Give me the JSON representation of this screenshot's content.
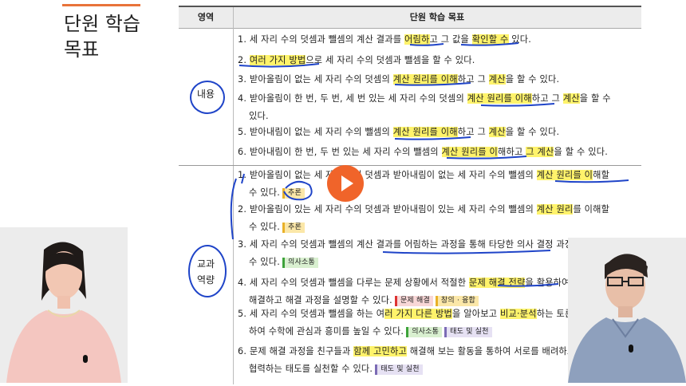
{
  "page": {
    "title_line1": "단원 학습",
    "title_line2": "목표"
  },
  "table": {
    "header_area": "영역",
    "header_goal": "단원 학습 목표",
    "sections": [
      {
        "area": "내용",
        "items": [
          {
            "n": "1.",
            "parts": [
              "세 자리 수의 덧셈과 뺄셈의 계산 결과를 ",
              "어림하",
              "고 그 값을 ",
              "확인할 수",
              " 있다."
            ]
          },
          {
            "n": "2.",
            "parts": [
              "",
              "여러 가지 방법",
              "으로 세 자리 수의 덧셈과 뺄셈을 할 수 있다."
            ]
          },
          {
            "n": "3.",
            "parts": [
              "받아올림이 없는 세 자리 수의 덧셈의 ",
              "계산 원리를 이해",
              "하고 그 ",
              "계산",
              "을 할 수 있다."
            ]
          },
          {
            "n": "4.",
            "parts": [
              "받아올림이 한 번, 두 번, 세 번 있는 세 자리 수의 덧셈의 ",
              "계산 원리를 이해",
              "하고 그 ",
              "계산",
              "을 할 수"
            ],
            "cont": "있다."
          },
          {
            "n": "5.",
            "parts": [
              "받아내림이 없는 세 자리 수의 뺄셈의 ",
              "계산 원리를 이해",
              "하고 그 ",
              "계산",
              "을 할 수 있다."
            ]
          },
          {
            "n": "6.",
            "parts": [
              "받아내림이 한 번, 두 번 있는 세 자리 수의 뺄셈의 ",
              "계산 원리를 이",
              "해하고 ",
              "그 계산",
              "을 할 수 있다."
            ]
          }
        ]
      },
      {
        "area_line1": "교과",
        "area_line2": "역량",
        "items": [
          {
            "n": "1.",
            "parts": [
              "받아올림이 없는 세 자리 수의 덧셈과 받아내림이 없는 세 자리 수의 뺄셈의 ",
              "계산 원리를 이",
              "해할"
            ],
            "cont": "수 있다.",
            "tags": [
              "추론"
            ]
          },
          {
            "n": "2.",
            "parts": [
              "받아올림이 있는 세 자리 수의 덧셈과 받아내림이 있는 세 자리 수의 뺄셈의 ",
              "계산 원리",
              "를 이해할"
            ],
            "cont": "수 있다.",
            "tags": [
              "추론"
            ]
          },
          {
            "n": "3.",
            "parts": [
              "세 자리 수의 덧셈과 뺄셈의 계산 결과를 어림하는 과정을 통해 타당한 의사 결정 과정을 설명할"
            ],
            "cont": "수 있다.",
            "tags": [
              "의사소통"
            ]
          },
          {
            "n": "4.",
            "parts": [
              "세 자리 수의 덧셈과 뺄셈을 다루는 문제 상황에서 적절한 ",
              "문제 해결 전략",
              "을 활용하여"
            ],
            "cont": "해결하고 해결 과정을 설명할 수 있다.",
            "tags": [
              "문제 해결",
              "창의 · 융합"
            ]
          },
          {
            "n": "5.",
            "parts": [
              "세 자리 수의 덧셈과 뺄셈을 하는 여",
              "러 가지 다른 방법",
              "을 알아보고 ",
              "비교·분석",
              "하는 토론 과정을"
            ],
            "cont": "하여 수학에 관심과 흥미를 높일 수 있다.",
            "tags": [
              "의사소통",
              "태도 및 실천"
            ]
          },
          {
            "n": "6.",
            "parts": [
              "문제 해결 과정을 친구들과 ",
              "함께 고민하고",
              " 해결해 보는 활동을 통하여 서로를 배려하고"
            ],
            "cont": "협력하는 태도를 실천할 수 있다.",
            "tags": [
              "태도 및 실천"
            ]
          }
        ]
      }
    ]
  },
  "colors": {
    "accent": "#e8733a",
    "highlight": "#fff36b",
    "ink": "#1f44c8",
    "play": "#f0642a"
  },
  "icons": {
    "play": "play-icon",
    "mic": "microphone-icon"
  }
}
